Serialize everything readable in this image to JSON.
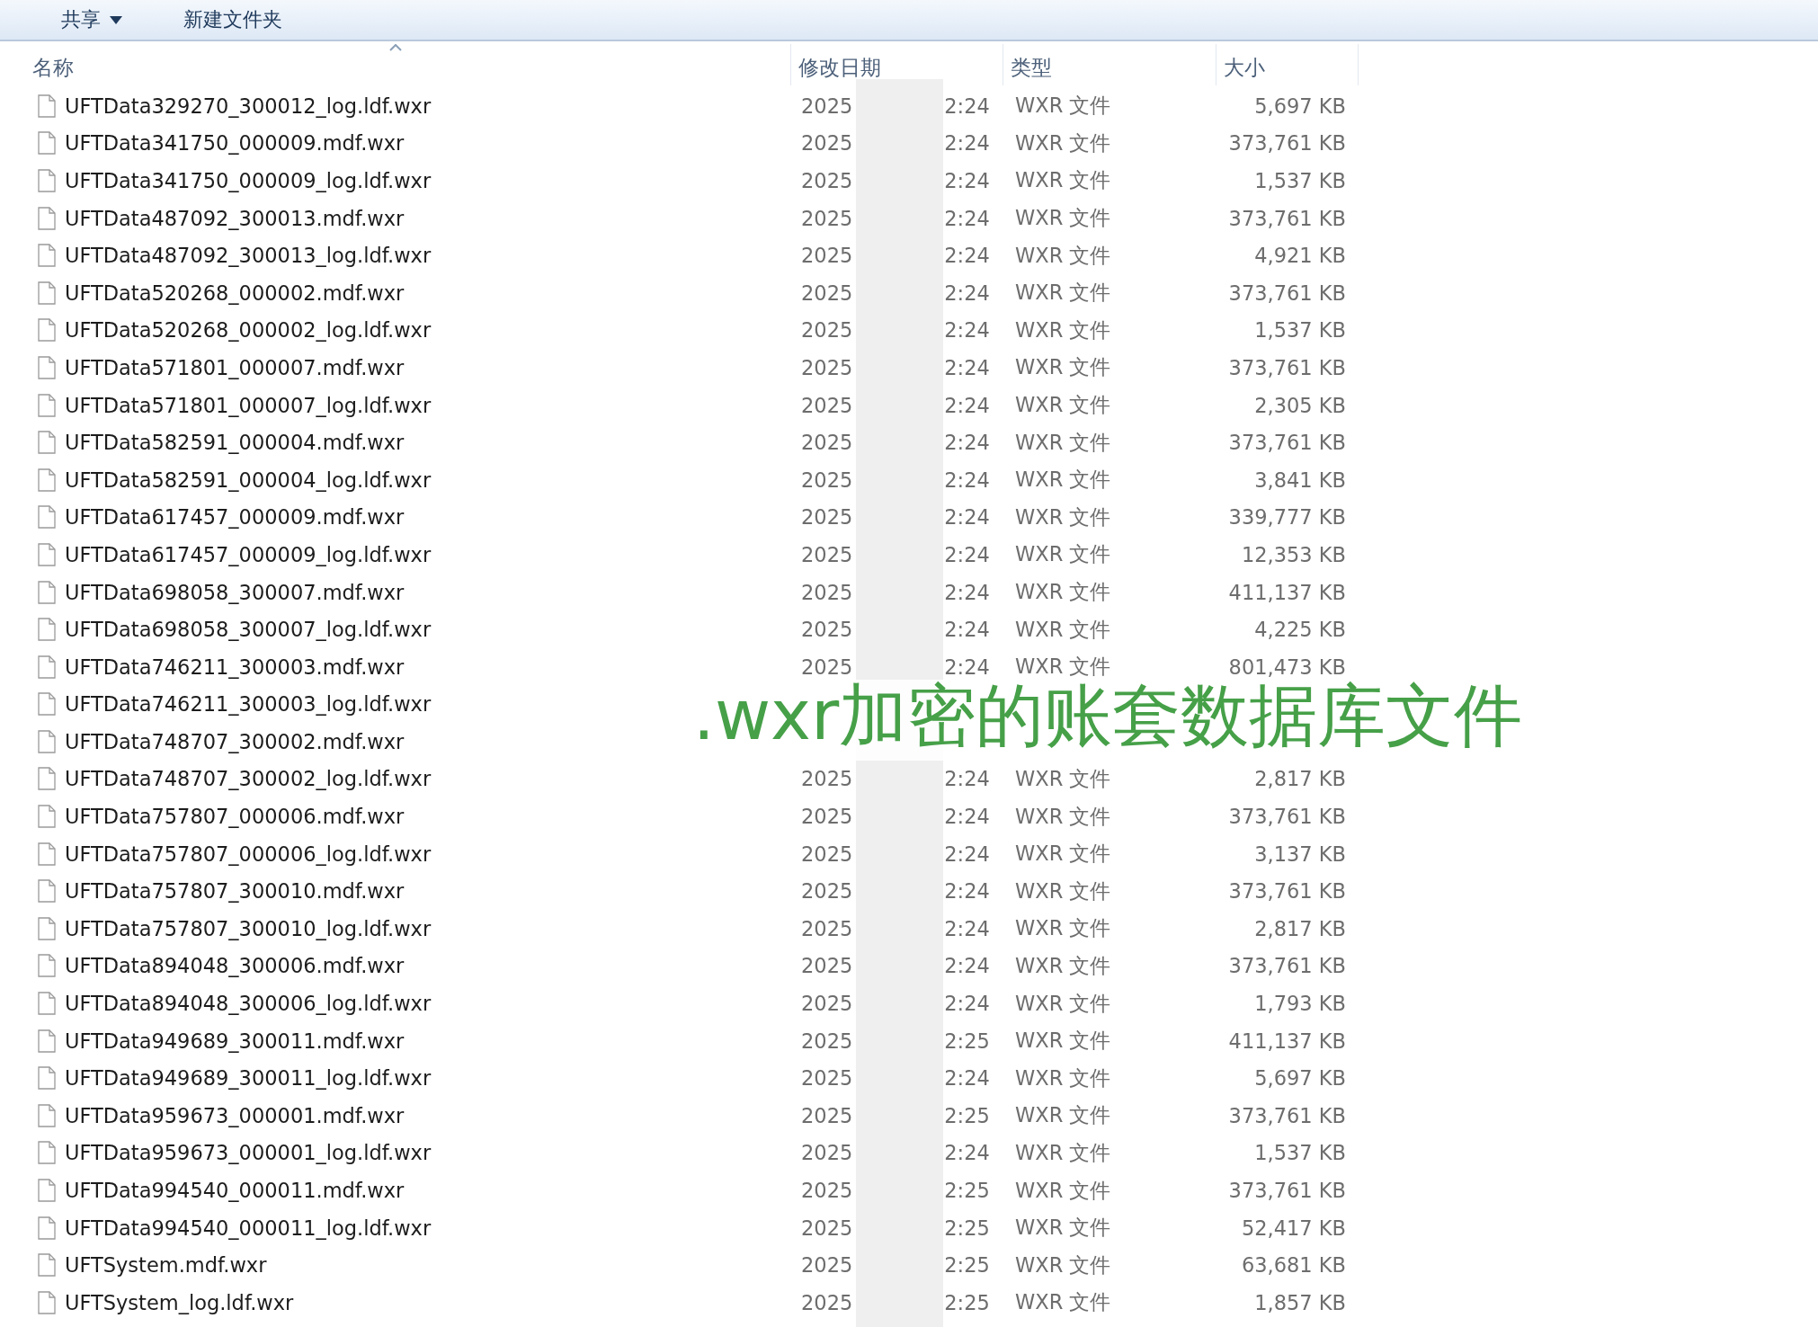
{
  "toolbar": {
    "buttons": [
      {
        "label": "共享",
        "has_menu": true
      },
      {
        "label": "新建文件夹",
        "has_menu": false
      }
    ]
  },
  "columns": [
    {
      "label": "名称",
      "sorted": true
    },
    {
      "label": "修改日期",
      "sorted": false
    },
    {
      "label": "类型",
      "sorted": false
    },
    {
      "label": "大小",
      "sorted": false
    }
  ],
  "rows": [
    {
      "name": "UFTData329270_300012_log.ldf.wxr",
      "date_start": "2025",
      "date_end": "2:24",
      "type": "WXR 文件",
      "size": "5,697 KB"
    },
    {
      "name": "UFTData341750_000009.mdf.wxr",
      "date_start": "2025",
      "date_end": "2:24",
      "type": "WXR 文件",
      "size": "373,761 KB"
    },
    {
      "name": "UFTData341750_000009_log.ldf.wxr",
      "date_start": "2025",
      "date_end": "2:24",
      "type": "WXR 文件",
      "size": "1,537 KB"
    },
    {
      "name": "UFTData487092_300013.mdf.wxr",
      "date_start": "2025",
      "date_end": "2:24",
      "type": "WXR 文件",
      "size": "373,761 KB"
    },
    {
      "name": "UFTData487092_300013_log.ldf.wxr",
      "date_start": "2025",
      "date_end": "2:24",
      "type": "WXR 文件",
      "size": "4,921 KB"
    },
    {
      "name": "UFTData520268_000002.mdf.wxr",
      "date_start": "2025",
      "date_end": "2:24",
      "type": "WXR 文件",
      "size": "373,761 KB"
    },
    {
      "name": "UFTData520268_000002_log.ldf.wxr",
      "date_start": "2025",
      "date_end": "2:24",
      "type": "WXR 文件",
      "size": "1,537 KB"
    },
    {
      "name": "UFTData571801_000007.mdf.wxr",
      "date_start": "2025",
      "date_end": "2:24",
      "type": "WXR 文件",
      "size": "373,761 KB"
    },
    {
      "name": "UFTData571801_000007_log.ldf.wxr",
      "date_start": "2025",
      "date_end": "2:24",
      "type": "WXR 文件",
      "size": "2,305 KB"
    },
    {
      "name": "UFTData582591_000004.mdf.wxr",
      "date_start": "2025",
      "date_end": "2:24",
      "type": "WXR 文件",
      "size": "373,761 KB"
    },
    {
      "name": "UFTData582591_000004_log.ldf.wxr",
      "date_start": "2025",
      "date_end": "2:24",
      "type": "WXR 文件",
      "size": "3,841 KB"
    },
    {
      "name": "UFTData617457_000009.mdf.wxr",
      "date_start": "2025",
      "date_end": "2:24",
      "type": "WXR 文件",
      "size": "339,777 KB"
    },
    {
      "name": "UFTData617457_000009_log.ldf.wxr",
      "date_start": "2025",
      "date_end": "2:24",
      "type": "WXR 文件",
      "size": "12,353 KB"
    },
    {
      "name": "UFTData698058_300007.mdf.wxr",
      "date_start": "2025",
      "date_end": "2:24",
      "type": "WXR 文件",
      "size": "411,137 KB"
    },
    {
      "name": "UFTData698058_300007_log.ldf.wxr",
      "date_start": "2025",
      "date_end": "2:24",
      "type": "WXR 文件",
      "size": "4,225 KB"
    },
    {
      "name": "UFTData746211_300003.mdf.wxr",
      "date_start": "2025",
      "date_end": "2:24",
      "type": "WXR 文件",
      "size": "801,473 KB"
    },
    {
      "name": "UFTData746211_300003_log.ldf.wxr"
    },
    {
      "name": "UFTData748707_300002.mdf.wxr"
    },
    {
      "name": "UFTData748707_300002_log.ldf.wxr",
      "date_start": "2025",
      "date_end": "2:24",
      "type": "WXR 文件",
      "size": "2,817 KB"
    },
    {
      "name": "UFTData757807_000006.mdf.wxr",
      "date_start": "2025",
      "date_end": "2:24",
      "type": "WXR 文件",
      "size": "373,761 KB"
    },
    {
      "name": "UFTData757807_000006_log.ldf.wxr",
      "date_start": "2025",
      "date_end": "2:24",
      "type": "WXR 文件",
      "size": "3,137 KB"
    },
    {
      "name": "UFTData757807_300010.mdf.wxr",
      "date_start": "2025",
      "date_end": "2:24",
      "type": "WXR 文件",
      "size": "373,761 KB"
    },
    {
      "name": "UFTData757807_300010_log.ldf.wxr",
      "date_start": "2025",
      "date_end": "2:24",
      "type": "WXR 文件",
      "size": "2,817 KB"
    },
    {
      "name": "UFTData894048_300006.mdf.wxr",
      "date_start": "2025",
      "date_end": "2:24",
      "type": "WXR 文件",
      "size": "373,761 KB"
    },
    {
      "name": "UFTData894048_300006_log.ldf.wxr",
      "date_start": "2025",
      "date_end": "2:24",
      "type": "WXR 文件",
      "size": "1,793 KB"
    },
    {
      "name": "UFTData949689_300011.mdf.wxr",
      "date_start": "2025",
      "date_end": "2:25",
      "type": "WXR 文件",
      "size": "411,137 KB"
    },
    {
      "name": "UFTData949689_300011_log.ldf.wxr",
      "date_start": "2025",
      "date_end": "2:24",
      "type": "WXR 文件",
      "size": "5,697 KB"
    },
    {
      "name": "UFTData959673_000001.mdf.wxr",
      "date_start": "2025",
      "date_end": "2:25",
      "type": "WXR 文件",
      "size": "373,761 KB"
    },
    {
      "name": "UFTData959673_000001_log.ldf.wxr",
      "date_start": "2025",
      "date_end": "2:24",
      "type": "WXR 文件",
      "size": "1,537 KB"
    },
    {
      "name": "UFTData994540_000011.mdf.wxr",
      "date_start": "2025",
      "date_end": "2:25",
      "type": "WXR 文件",
      "size": "373,761 KB"
    },
    {
      "name": "UFTData994540_000011_log.ldf.wxr",
      "date_start": "2025",
      "date_end": "2:25",
      "type": "WXR 文件",
      "size": "52,417 KB"
    },
    {
      "name": "UFTSystem.mdf.wxr",
      "date_start": "2025",
      "date_end": "2:25",
      "type": "WXR 文件",
      "size": "63,681 KB"
    },
    {
      "name": "UFTSystem_log.ldf.wxr",
      "date_start": "2025",
      "date_end": "2:25",
      "type": "WXR 文件",
      "size": "1,857 KB"
    }
  ],
  "overlay_caption": ".wxr加密的账套数据库文件"
}
